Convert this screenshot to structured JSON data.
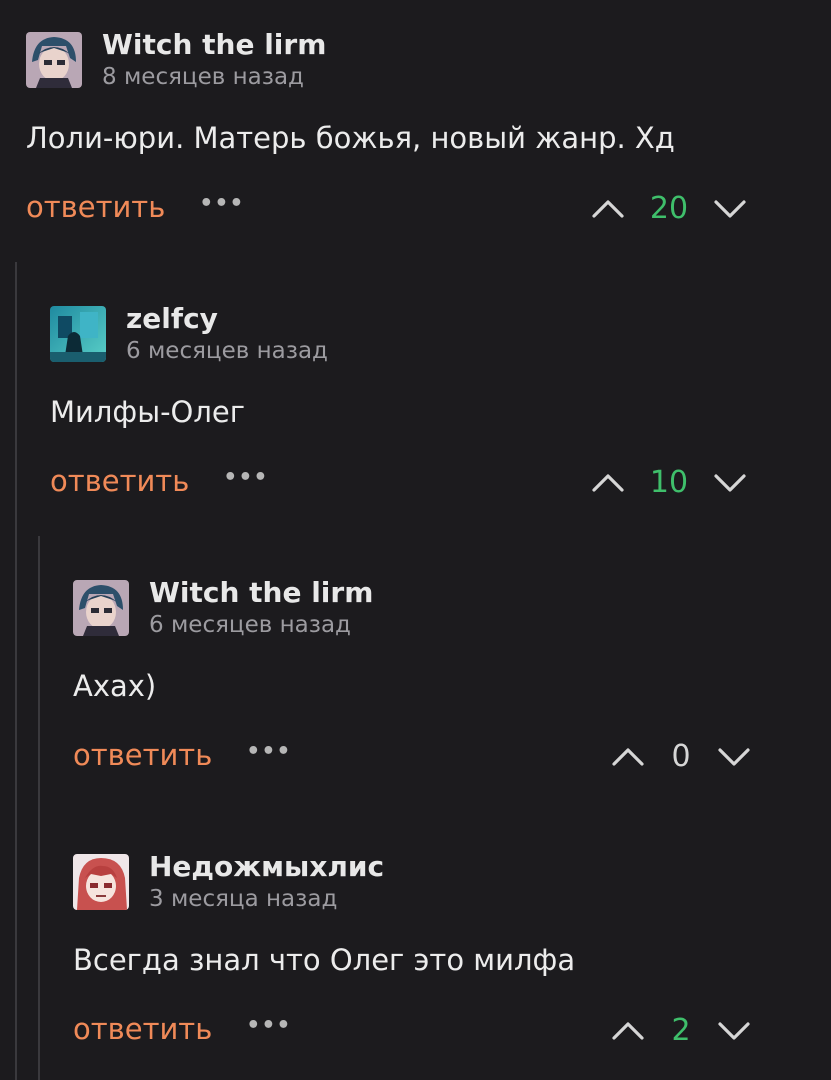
{
  "colors": {
    "background": "#1c1b1e",
    "reply_accent": "#f08a58",
    "positive_score": "#3fbf6b",
    "thread_line": "#3a393d"
  },
  "comments": [
    {
      "author": "Witch the lirm",
      "time": "8 месяцев назад",
      "text": "Лоли-юри. Матерь божья, новый жанр. Хд",
      "reply_label": "ответить",
      "more_icon": "ellipsis-icon",
      "score": "20",
      "avatar": "anime-avatar-blue-hair"
    },
    {
      "author": "zelfcy",
      "time": "6 месяцев назад",
      "text": "Милфы-Олег",
      "reply_label": "ответить",
      "more_icon": "ellipsis-icon",
      "score": "10",
      "avatar": "teal-scene-avatar"
    },
    {
      "author": "Witch the lirm",
      "time": "6 месяцев назад",
      "text": "Ахах)",
      "reply_label": "ответить",
      "more_icon": "ellipsis-icon",
      "score": "0",
      "avatar": "anime-avatar-blue-hair"
    },
    {
      "author": "Недожмыхлис",
      "time": "3 месяца назад",
      "text": "Всегда знал что Олег это милфа",
      "reply_label": "ответить",
      "more_icon": "ellipsis-icon",
      "score": "2",
      "avatar": "anime-avatar-red-hair"
    }
  ]
}
